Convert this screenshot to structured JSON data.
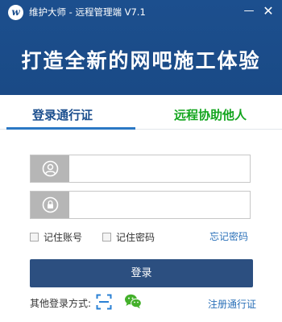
{
  "window": {
    "logo_letter": "w",
    "title": "维护大师 - 远程管理端 V7.1",
    "minimize": "—",
    "close": "✕"
  },
  "banner": {
    "slogan": "打造全新的网吧施工体验"
  },
  "tabs": {
    "login": "登录通行证",
    "remote_help": "远程协助他人"
  },
  "form": {
    "username": {
      "value": "",
      "placeholder": ""
    },
    "password": {
      "value": "",
      "placeholder": ""
    },
    "remember_account": "记住账号",
    "remember_password": "记住密码",
    "forgot_password": "忘记密码",
    "login_button": "登录"
  },
  "footer": {
    "other_login_label": "其他登录方式:",
    "register": "注册通行证"
  },
  "icons": {
    "user": "user-icon",
    "lock": "lock-icon",
    "scan": "scan-icon",
    "wechat": "wechat-icon"
  },
  "colors": {
    "header_bg": "#1c4f8e",
    "login_button": "#2c4f80",
    "active_tab": "#1c4f8e",
    "remote_tab": "#13a51e",
    "link": "#2a70b8"
  }
}
